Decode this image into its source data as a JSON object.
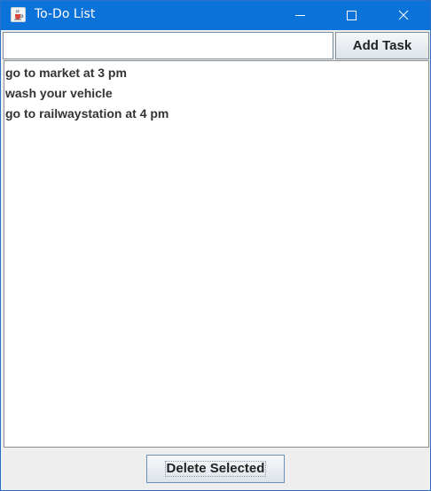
{
  "window": {
    "title": "To-Do List",
    "icon": "java-cup-icon"
  },
  "titlebar_controls": {
    "minimize_icon": "minimize-icon",
    "maximize_icon": "maximize-icon",
    "close_icon": "close-icon"
  },
  "input": {
    "value": "",
    "placeholder": ""
  },
  "add_button": {
    "label": "Add Task"
  },
  "tasks": [
    "go to market at 3 pm",
    "wash your vehicle",
    "go to railwaystation at 4 pm"
  ],
  "delete_button": {
    "label": "Delete Selected"
  },
  "colors": {
    "titlebar": "#0a72d8",
    "list_background": "#ffffff",
    "panel_background": "#eeeeee"
  }
}
